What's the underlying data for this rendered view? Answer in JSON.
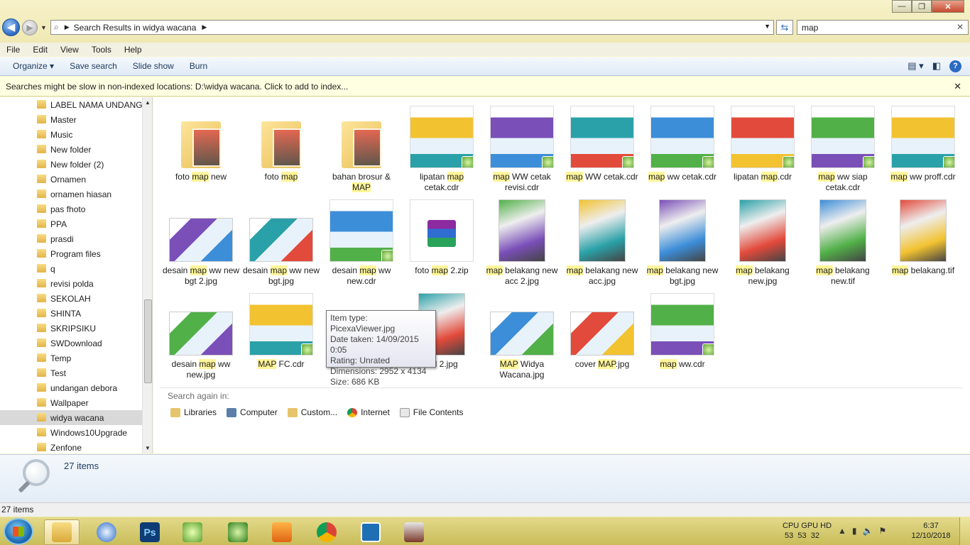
{
  "window": {
    "minimize": "—",
    "maximize": "❐",
    "close": "✕"
  },
  "address": {
    "crumb": "Search Results in widya wacana"
  },
  "search": {
    "value": "map"
  },
  "menu": [
    "File",
    "Edit",
    "View",
    "Tools",
    "Help"
  ],
  "commands": {
    "organize": "Organize ▾",
    "save_search": "Save search",
    "slide_show": "Slide show",
    "burn": "Burn"
  },
  "infobar": {
    "text": "Searches might be slow in non-indexed locations: D:\\widya wacana. Click to add to index..."
  },
  "nav": {
    "items": [
      "LABEL NAMA UNDANG...",
      "Master",
      "Music",
      "New folder",
      "New folder (2)",
      "Ornamen",
      "ornamen hiasan",
      "pas fhoto",
      "PPA",
      "prasdi",
      "Program files",
      "q",
      "revisi polda",
      "SEKOLAH",
      "SHINTA",
      "SKRIPSIKU",
      "SWDownload",
      "Temp",
      "Test",
      "undangan debora",
      "Wallpaper",
      "widya wacana",
      "Windows10Upgrade",
      "Zenfone"
    ],
    "selected_index": 21
  },
  "files": [
    {
      "pre": "foto ",
      "hl": "map",
      "post": " new",
      "kind": "folder"
    },
    {
      "pre": "foto ",
      "hl": "map",
      "post": "",
      "kind": "folder"
    },
    {
      "pre": "bahan brosur & ",
      "hl": "MAP",
      "post": "",
      "kind": "folder"
    },
    {
      "pre": "lipatan ",
      "hl": "map",
      "post": " cetak.cdr",
      "kind": "cdr"
    },
    {
      "pre": "",
      "hl": "map",
      "post": " WW cetak revisi.cdr",
      "kind": "cdr"
    },
    {
      "pre": "",
      "hl": "map",
      "post": " WW cetak.cdr",
      "kind": "cdr"
    },
    {
      "pre": "",
      "hl": "map",
      "post": " ww cetak.cdr",
      "kind": "cdr"
    },
    {
      "pre": "lipatan ",
      "hl": "map",
      "post": ".cdr",
      "kind": "cdr"
    },
    {
      "pre": "",
      "hl": "map",
      "post": " ww siap cetak.cdr",
      "kind": "cdr"
    },
    {
      "pre": "",
      "hl": "map",
      "post": " ww proff.cdr",
      "kind": "cdr"
    },
    {
      "pre": "desain ",
      "hl": "map",
      "post": " ww new bgt 2.jpg",
      "kind": "img"
    },
    {
      "pre": "desain ",
      "hl": "map",
      "post": " ww new bgt.jpg",
      "kind": "img"
    },
    {
      "pre": "desain ",
      "hl": "map",
      "post": " ww new.cdr",
      "kind": "cdr"
    },
    {
      "pre": "foto ",
      "hl": "map",
      "post": " 2.zip",
      "kind": "zip"
    },
    {
      "pre": "",
      "hl": "map",
      "post": " belakang new acc 2.jpg",
      "kind": "tall"
    },
    {
      "pre": "",
      "hl": "map",
      "post": " belakang new acc.jpg",
      "kind": "tall"
    },
    {
      "pre": "",
      "hl": "map",
      "post": " belakang new bgt.jpg",
      "kind": "tall"
    },
    {
      "pre": "",
      "hl": "map",
      "post": " belakang new.jpg",
      "kind": "tall"
    },
    {
      "pre": "",
      "hl": "map",
      "post": " belakang new.tif",
      "kind": "tall"
    },
    {
      "pre": "",
      "hl": "map",
      "post": " belakang.tif",
      "kind": "tall"
    },
    {
      "pre": "desain ",
      "hl": "map",
      "post": " ww new.jpg",
      "kind": "img"
    },
    {
      "pre": "",
      "hl": "MAP",
      "post": " FC.cdr",
      "kind": "cdr"
    },
    {
      "pre": "",
      "hl": "",
      "post": "",
      "kind": "img"
    },
    {
      "pre": "",
      "hl": "",
      "post": "hal 2.jpg",
      "kind": "tall"
    },
    {
      "pre": "",
      "hl": "MAP",
      "post": " Widya Wacana.jpg",
      "kind": "img"
    },
    {
      "pre": "cover ",
      "hl": "MAP",
      "post": ".jpg",
      "kind": "img"
    },
    {
      "pre": "",
      "hl": "map",
      "post": " ww.cdr",
      "kind": "cdr"
    }
  ],
  "search_again": {
    "label": "Search again in:",
    "locations": [
      "Libraries",
      "Computer",
      "Custom...",
      "Internet",
      "File Contents"
    ]
  },
  "tooltip": {
    "type": "Item type: PicexaViewer.jpg",
    "date": "Date taken: 14/09/2015 0:05",
    "rating": "Rating: Unrated",
    "dims": "Dimensions: 2952 x 4134",
    "size": "Size: 686 KB"
  },
  "details": {
    "count": "27 items"
  },
  "status": {
    "text": "27 items"
  },
  "tray": {
    "cpu_label": "CPU GPU HD",
    "cpu_values": "53  53  32",
    "time": "6:37",
    "date": "12/10/2018"
  }
}
